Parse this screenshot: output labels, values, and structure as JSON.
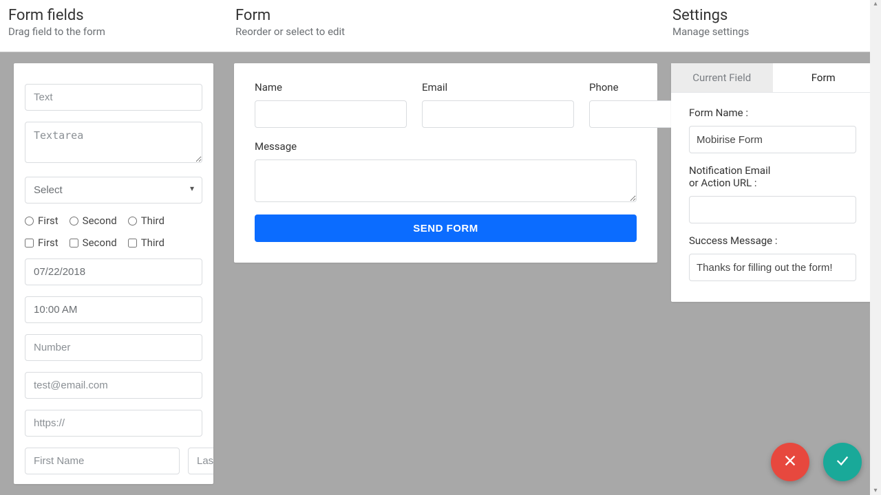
{
  "header": {
    "fields": {
      "title": "Form fields",
      "subtitle": "Drag field to the form"
    },
    "form": {
      "title": "Form",
      "subtitle": "Reorder or select to edit"
    },
    "settings": {
      "title": "Settings",
      "subtitle": "Manage settings"
    }
  },
  "palette": {
    "text_placeholder": "Text",
    "textarea_placeholder": "Textarea",
    "select_placeholder": "Select",
    "radio": {
      "first": "First",
      "second": "Second",
      "third": "Third"
    },
    "checkbox": {
      "first": "First",
      "second": "Second",
      "third": "Third"
    },
    "date_value": "07/22/2018",
    "time_value": "10:00 AM",
    "number_placeholder": "Number",
    "email_placeholder": "test@email.com",
    "url_placeholder": "https://",
    "first_name_placeholder": "First Name",
    "last_name_placeholder": "Last Name"
  },
  "form": {
    "name_label": "Name",
    "email_label": "Email",
    "phone_label": "Phone",
    "message_label": "Message",
    "submit_label": "SEND FORM"
  },
  "settings": {
    "tab_current": "Current Field",
    "tab_form": "Form",
    "form_name_label": "Form Name :",
    "form_name_value": "Mobirise Form",
    "notify_label_line1": "Notification Email",
    "notify_label_line2": "or Action URL :",
    "notify_value": "",
    "success_label": "Success Message :",
    "success_value": "Thanks for filling out the form!"
  },
  "colors": {
    "primary": "#0b6cff",
    "danger": "#e7483e",
    "success": "#19a999"
  }
}
